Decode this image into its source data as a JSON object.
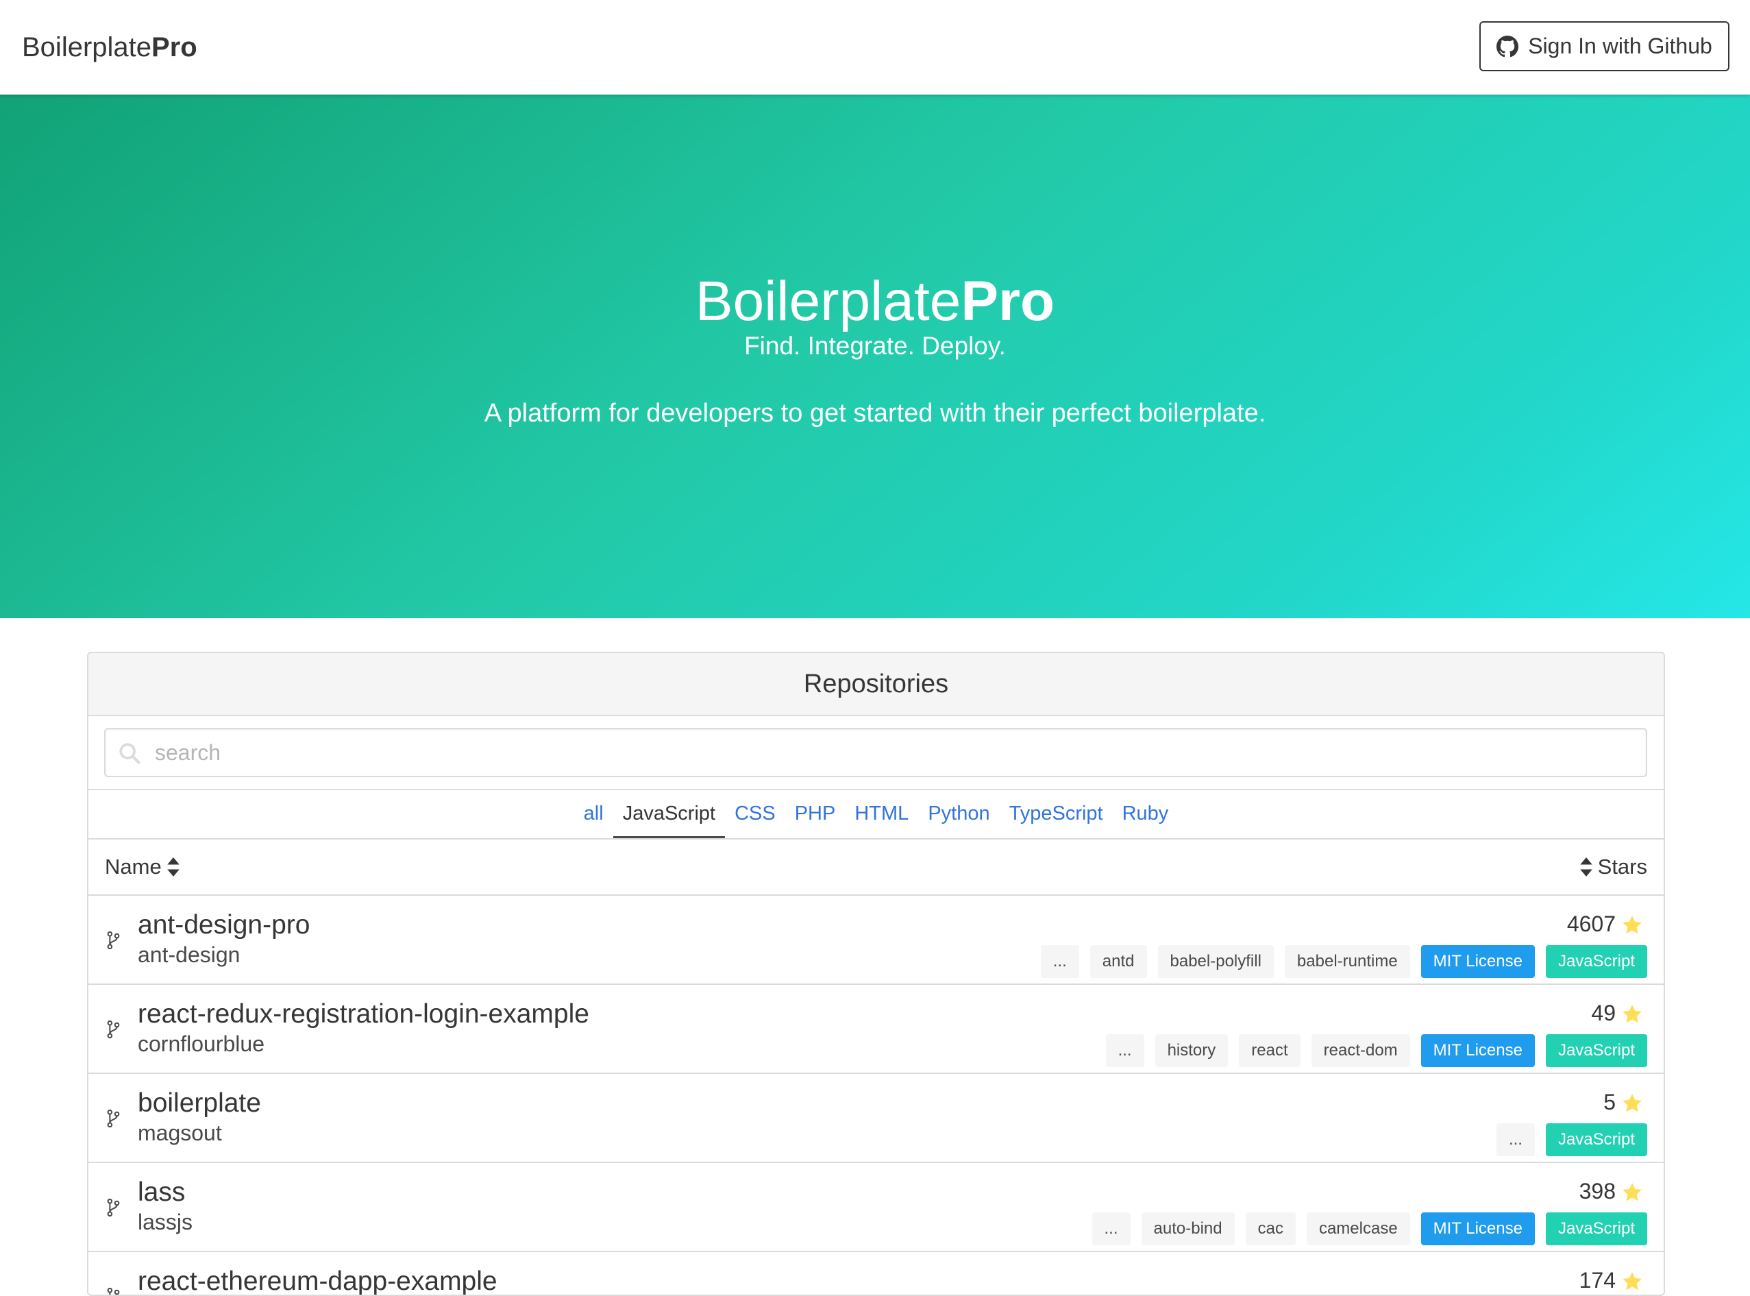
{
  "navbar": {
    "brand_light": "Boilerplate",
    "brand_bold": "Pro",
    "signin_label": "Sign In with Github"
  },
  "hero": {
    "title_light": "Boilerplate",
    "title_bold": "Pro",
    "subtitle": "Find. Integrate. Deploy.",
    "description": "A platform for developers to get started with their perfect boilerplate."
  },
  "panel": {
    "heading": "Repositories",
    "search_placeholder": "search",
    "search_value": "",
    "tabs": [
      "all",
      "JavaScript",
      "CSS",
      "PHP",
      "HTML",
      "Python",
      "TypeScript",
      "Ruby"
    ],
    "active_tab": "JavaScript",
    "columns": {
      "name": "Name",
      "stars": "Stars"
    }
  },
  "repos": [
    {
      "name": "ant-design-pro",
      "owner": "ant-design",
      "stars": "4607",
      "tags": [
        "...",
        "antd",
        "babel-polyfill",
        "babel-runtime"
      ],
      "license": "MIT License",
      "language": "JavaScript"
    },
    {
      "name": "react-redux-registration-login-example",
      "owner": "cornflourblue",
      "stars": "49",
      "tags": [
        "...",
        "history",
        "react",
        "react-dom"
      ],
      "license": "MIT License",
      "language": "JavaScript"
    },
    {
      "name": "boilerplate",
      "owner": "magsout",
      "stars": "5",
      "tags": [
        "..."
      ],
      "license": "",
      "language": "JavaScript"
    },
    {
      "name": "lass",
      "owner": "lassjs",
      "stars": "398",
      "tags": [
        "...",
        "auto-bind",
        "cac",
        "camelcase"
      ],
      "license": "MIT License",
      "language": "JavaScript"
    },
    {
      "name": "react-ethereum-dapp-example",
      "owner": "",
      "stars": "174",
      "tags": [],
      "license": "",
      "language": ""
    }
  ],
  "icons": {
    "signin": "github-icon",
    "search": "search-icon",
    "sort": "sort-icon",
    "repo": "code-branch-icon",
    "star": "star-icon"
  },
  "colors": {
    "link": "#3273dc",
    "license_tag": "#209cee",
    "language_tag": "#22d0b2",
    "star": "#ffdd57",
    "hero_gradient_start": "#12a276",
    "hero_gradient_end": "#25e7e7"
  }
}
